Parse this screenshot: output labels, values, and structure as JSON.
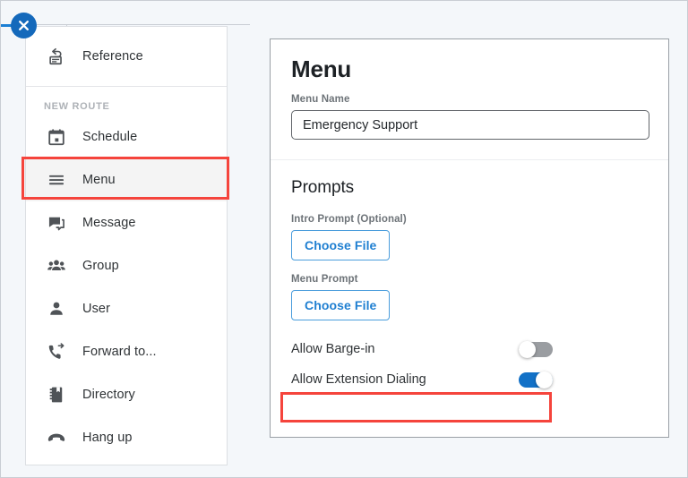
{
  "canvas": {
    "close_button_label": "×",
    "accent_blue": "#1469bb",
    "highlight_red": "#f5443c"
  },
  "route_panel": {
    "reference": {
      "label": "Reference",
      "icon": "reply-card-icon"
    },
    "group_header": "NEW ROUTE",
    "items": [
      {
        "label": "Schedule",
        "icon": "calendar-icon",
        "selected": false
      },
      {
        "label": "Menu",
        "icon": "hamburger-menu-icon",
        "selected": true
      },
      {
        "label": "Message",
        "icon": "chat-bubble-icon",
        "selected": false
      },
      {
        "label": "Group",
        "icon": "people-group-icon",
        "selected": false
      },
      {
        "label": "User",
        "icon": "person-icon",
        "selected": false
      },
      {
        "label": "Forward to...",
        "icon": "phone-forward-icon",
        "selected": false
      },
      {
        "label": "Directory",
        "icon": "address-book-icon",
        "selected": false
      },
      {
        "label": "Hang up",
        "icon": "phone-hangup-icon",
        "selected": false
      }
    ]
  },
  "detail": {
    "title": "Menu",
    "menu_name": {
      "label": "Menu Name",
      "value": "Emergency Support",
      "placeholder": "Menu Name"
    },
    "prompts": {
      "title": "Prompts",
      "intro_prompt": {
        "label": "Intro Prompt (Optional)",
        "button": "Choose File"
      },
      "menu_prompt": {
        "label": "Menu Prompt",
        "button": "Choose File"
      }
    },
    "toggles": [
      {
        "label": "Allow Barge-in",
        "state": "off"
      },
      {
        "label": "Allow Extension Dialing",
        "state": "on"
      }
    ]
  }
}
